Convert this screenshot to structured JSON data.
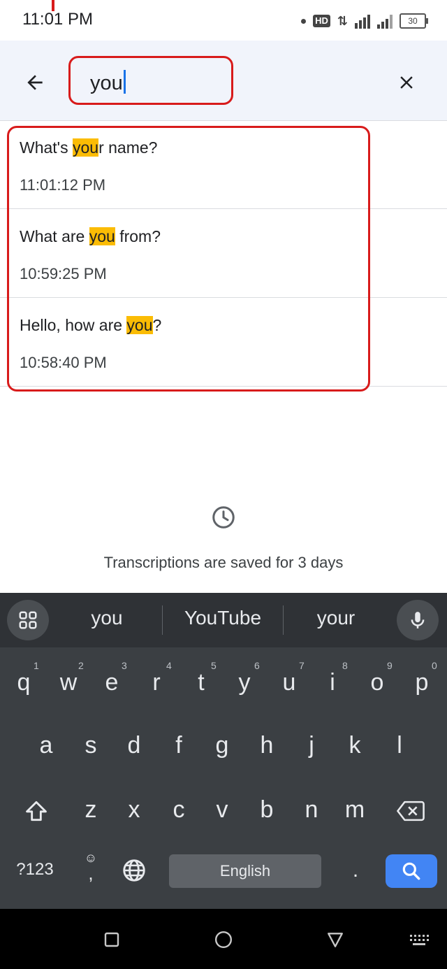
{
  "status": {
    "time": "11:01 PM",
    "battery": "30"
  },
  "search": {
    "query": "you"
  },
  "results": [
    {
      "before": "What's ",
      "match": "you",
      "after": "r name?",
      "time": "11:01:12 PM"
    },
    {
      "before": "What are ",
      "match": "you",
      "after": " from?",
      "time": "10:59:25 PM"
    },
    {
      "before": "Hello, how are ",
      "match": "you",
      "after": "?",
      "time": "10:58:40 PM"
    }
  ],
  "info_text": "Transcriptions are saved for 3 days",
  "keyboard": {
    "suggestions": [
      "you",
      "YouTube",
      "your"
    ],
    "row1": [
      "q",
      "w",
      "e",
      "r",
      "t",
      "y",
      "u",
      "i",
      "o",
      "p"
    ],
    "row1_hints": [
      "1",
      "2",
      "3",
      "4",
      "5",
      "6",
      "7",
      "8",
      "9",
      "0"
    ],
    "row2": [
      "a",
      "s",
      "d",
      "f",
      "g",
      "h",
      "j",
      "k",
      "l"
    ],
    "row3": [
      "z",
      "x",
      "c",
      "v",
      "b",
      "n",
      "m"
    ],
    "symbols_label": "?123",
    "comma_label": ",",
    "period_label": ".",
    "space_label": "English"
  },
  "colors": {
    "highlight": "#fbbc04",
    "annotation": "#d81b1b",
    "search_key": "#4285f4"
  }
}
